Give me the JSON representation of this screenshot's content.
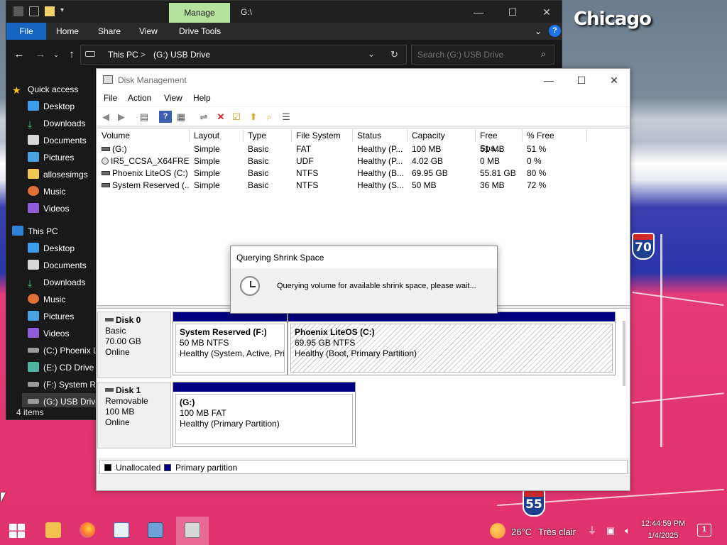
{
  "desktop": {
    "city_label": "Chicago",
    "shields": [
      "70",
      "55"
    ]
  },
  "explorer": {
    "title_path": "G:\\",
    "manage_tab": "Manage",
    "ribbon": {
      "file": "File",
      "home": "Home",
      "share": "Share",
      "view": "View",
      "drive_tools": "Drive Tools"
    },
    "address": {
      "this_pc": "This PC",
      "sep": ">",
      "current": "(G:) USB Drive"
    },
    "search_placeholder": "Search (G:) USB Drive",
    "nav": {
      "quick_access": "Quick access",
      "qa_items": [
        "Desktop",
        "Downloads",
        "Documents",
        "Pictures",
        "allosesimgs",
        "Music",
        "Videos"
      ],
      "this_pc": "This PC",
      "pc_items": [
        "Desktop",
        "Documents",
        "Downloads",
        "Music",
        "Pictures",
        "Videos",
        "(C:) Phoenix L",
        "(E:) CD Drive -",
        "(F:) System Re",
        "(G:) USB Drive"
      ]
    },
    "status": "4 items"
  },
  "disk_management": {
    "title": "Disk Management",
    "menu": [
      "File",
      "Action",
      "View",
      "Help"
    ],
    "columns": [
      "Volume",
      "Layout",
      "Type",
      "File System",
      "Status",
      "Capacity",
      "Free Spa...",
      "% Free"
    ],
    "volumes": [
      {
        "volume": "(G:)",
        "layout": "Simple",
        "type": "Basic",
        "fs": "FAT",
        "status": "Healthy (P...",
        "capacity": "100 MB",
        "free": "51 MB",
        "pct": "51 %"
      },
      {
        "volume": "IR5_CCSA_X64FRE...",
        "layout": "Simple",
        "type": "Basic",
        "fs": "UDF",
        "status": "Healthy (P...",
        "capacity": "4.02 GB",
        "free": "0 MB",
        "pct": "0 %"
      },
      {
        "volume": "Phoenix LiteOS (C:)",
        "layout": "Simple",
        "type": "Basic",
        "fs": "NTFS",
        "status": "Healthy (B...",
        "capacity": "69.95 GB",
        "free": "55.81 GB",
        "pct": "80 %"
      },
      {
        "volume": "System Reserved (...",
        "layout": "Simple",
        "type": "Basic",
        "fs": "NTFS",
        "status": "Healthy (S...",
        "capacity": "50 MB",
        "free": "36 MB",
        "pct": "72 %"
      }
    ],
    "disk0": {
      "name": "Disk 0",
      "kind": "Basic",
      "size": "70.00 GB",
      "state": "Online",
      "parts": [
        {
          "title": "System Reserved  (F:)",
          "size": "50 MB NTFS",
          "status": "Healthy (System, Active, Pri"
        },
        {
          "title": "Phoenix LiteOS  (C:)",
          "size": "69.95 GB NTFS",
          "status": "Healthy (Boot, Primary Partition)"
        }
      ]
    },
    "disk1": {
      "name": "Disk 1",
      "kind": "Removable",
      "size": "100 MB",
      "state": "Online",
      "parts": [
        {
          "title": "(G:)",
          "size": "100 MB FAT",
          "status": "Healthy (Primary Partition)"
        }
      ]
    },
    "legend": {
      "unallocated": "Unallocated",
      "primary": "Primary partition",
      "unallocated_color": "#000000",
      "primary_color": "#000080"
    }
  },
  "dialog": {
    "title": "Querying Shrink Space",
    "message": "Querying volume for available shrink space, please wait..."
  },
  "taskbar": {
    "apps": [
      "start-icon",
      "file-explorer-icon",
      "firefox-icon",
      "notepad-icon",
      "computer-management-icon",
      "disk-management-icon"
    ],
    "weather_temp": "26°C",
    "weather_desc": "Très clair",
    "time": "12:44:59 PM",
    "date": "1/4/2025",
    "notification_count": "1"
  },
  "colors": {
    "accent": "#1565c0",
    "manage_tab": "#b6e2a0",
    "partition_bar": "#000080"
  }
}
